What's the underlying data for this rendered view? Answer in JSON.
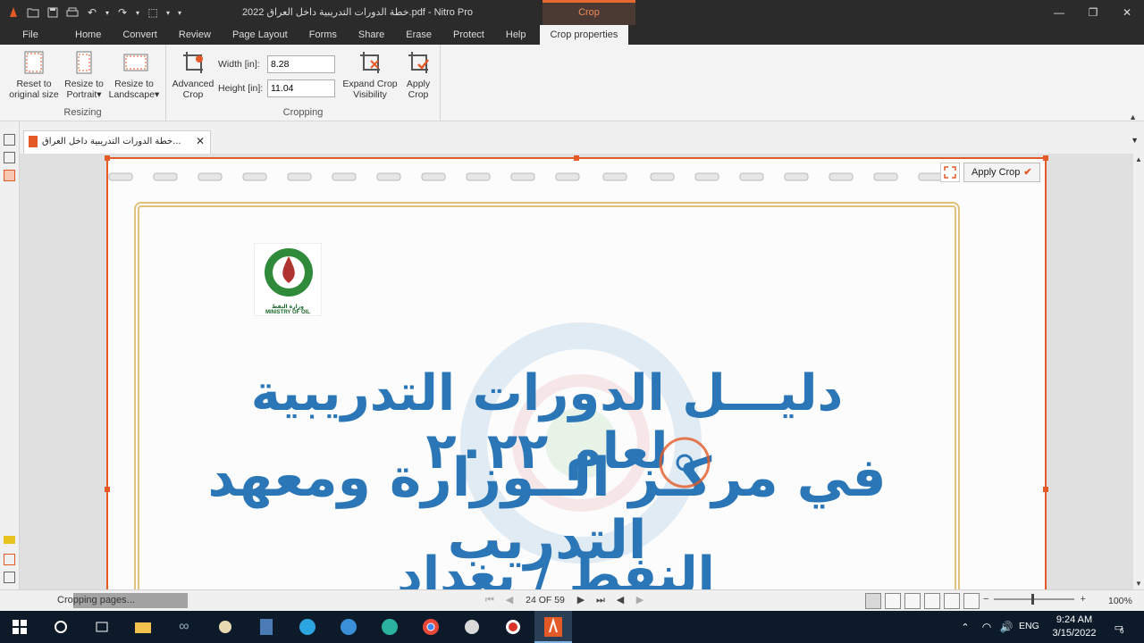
{
  "window": {
    "title": "خطة الدورات التدريبية داخل العراق 2022.pdf - Nitro Pro",
    "context_tab_header": "Crop"
  },
  "tabs": [
    "File",
    "Home",
    "Convert",
    "Review",
    "Page Layout",
    "Forms",
    "Share",
    "Erase",
    "Protect",
    "Help",
    "Crop properties"
  ],
  "ribbon": {
    "resizing": {
      "label": "Resizing",
      "reset": "Reset to original size",
      "reset_l1": "Reset to",
      "reset_l2": "original size",
      "portrait_l1": "Resize to",
      "portrait_l2": "Portrait",
      "landscape_l1": "Resize to",
      "landscape_l2": "Landscape"
    },
    "cropping": {
      "label": "Cropping",
      "advanced_l1": "Advanced",
      "advanced_l2": "Crop",
      "width_label": "Width [in]:",
      "width_value": "8.28",
      "height_label": "Height [in]:",
      "height_value": "11.04",
      "expand_l1": "Expand Crop",
      "expand_l2": "Visibility",
      "apply_l1": "Apply",
      "apply_l2": "Crop"
    }
  },
  "document": {
    "tab_title": "خطة الدورات التدريبية داخل العراق...",
    "apply_crop_label": "Apply Crop",
    "line1": "دليـــل الدورات التدريبية لعام ٢٠٢٢",
    "line2": "في مركـز الــوزارة ومعهد التدريب",
    "line3": "النفط / بغداد",
    "logo_text": "وزارة النفط",
    "logo_en": "MINISTRY OF OIL",
    "logo_iraq": "IRAQ"
  },
  "status": {
    "text": "Cropping pages...",
    "page_indicator": "24 OF 59",
    "zoom": "100%"
  },
  "taskbar": {
    "lang": "ENG",
    "time": "9:24 AM",
    "date": "3/15/2022",
    "notifications": "6"
  },
  "colors": {
    "accent": "#e45a27",
    "arabic_text": "#2a76b6",
    "titlebar": "#2b2b2b",
    "ribbon": "#f3f3f3"
  }
}
